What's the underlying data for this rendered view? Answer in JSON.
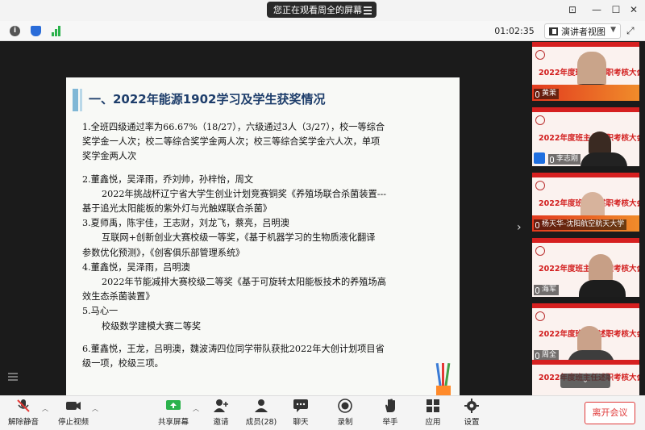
{
  "titlebar": {
    "share_notice": "您正在观看周全的屏幕"
  },
  "toolbar": {
    "timer": "01:02:35",
    "speaker_view_label": "演讲者视图"
  },
  "slide": {
    "title": "一、2022年能源1902学习及学生获奖情况",
    "lines": [
      "1.全班四级通过率为66.67%（18/27），六级通过3人（3/27），校一等综合",
      "奖学金一人次；校二等综合奖学金两人次；校三等综合奖学金六人次，单项",
      "奖学金两人次",
      "2.董鑫悦，吴泽雨，乔刘帅，孙梓怡，周文",
      "2022年挑战杯辽宁省大学生创业计划竞赛铜奖《养殖场联合杀菌装置---",
      "基于追光太阳能板的紫外灯与光触媒联合杀菌》",
      "3.夏师禹，陈宇佳，王志财，刘龙飞，蔡亮，吕明澳",
      "互联网+创新创业大赛校级一等奖，《基于机器学习的生物质液化翻译",
      "参数优化预测》，《创客俱乐部管理系统》",
      "4.董鑫悦，吴泽雨，吕明澳",
      "2022年节能减排大赛校级二等奖《基于可旋转太阳能板技术的养殖场高",
      "效生态杀菌装置》",
      "5.马心一",
      "校级数学建模大赛二等奖",
      "6.董鑫悦，王龙，吕明澳，魏波涛四位同学带队获批2022年大创计划项目省",
      "级一项，校级三项。"
    ]
  },
  "participants": [
    {
      "name": "黄茉",
      "banner": "2022年度班主任述职考核大会"
    },
    {
      "name": "李志刚",
      "banner": "2022年度班主任述职考核大会"
    },
    {
      "name": "杨天华-沈阳航空航天大学",
      "banner": "2022年度班主任述职考核大会"
    },
    {
      "name": "海军",
      "banner": "2022年度班主任述职考核大会"
    },
    {
      "name": "周全",
      "banner": "2022年度班主任述职考核大会"
    },
    {
      "name": "",
      "banner": "2022年度班主任述职考核大会"
    }
  ],
  "bottombar": {
    "unmute": "解除静音",
    "stop_video": "停止视频",
    "share_screen": "共享屏幕",
    "invite": "邀请",
    "members": "成员(28)",
    "chat": "聊天",
    "record": "录制",
    "raise_hand": "举手",
    "apps": "应用",
    "settings": "设置",
    "leave": "离开会议"
  },
  "colors": {
    "slide_title": "#1e3e6b",
    "banner_red": "#d21d1d",
    "leave_red": "#e03a3a"
  }
}
